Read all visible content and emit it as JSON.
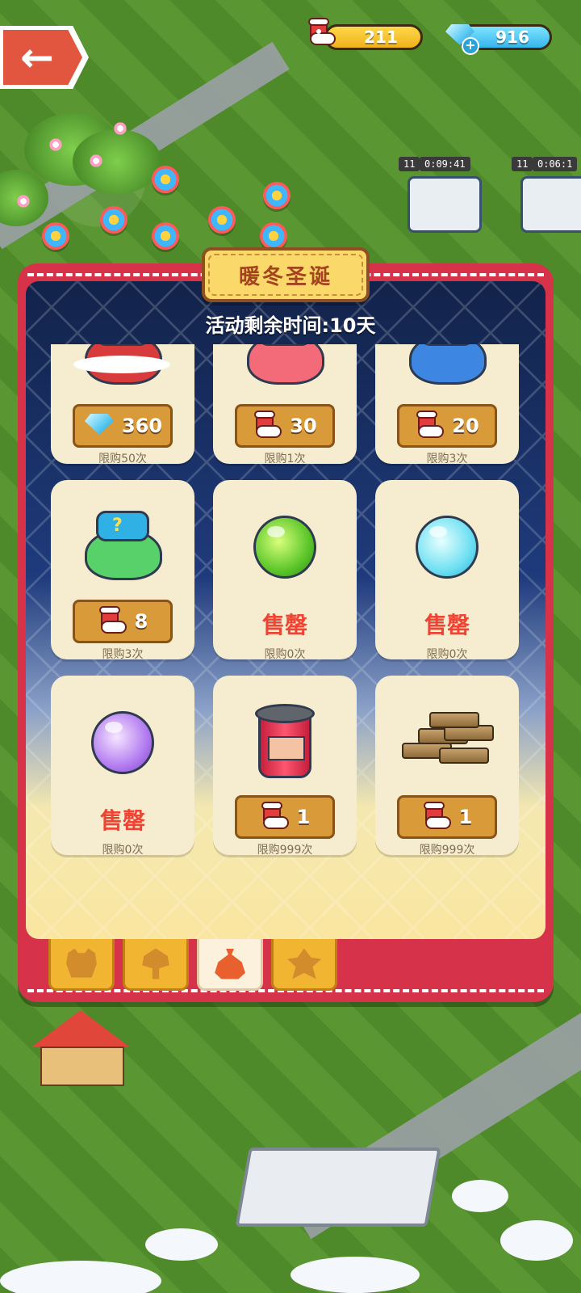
{
  "hud": {
    "sock_count": "211",
    "gem_count": "916",
    "back_icon": "back-arrow-icon",
    "sock_icon": "christmas-sock-icon",
    "gem_icon": "diamond-plus-icon"
  },
  "world": {
    "timer_a": "0:09:41",
    "timer_b": "0:06:1",
    "level_a": "11",
    "level_b": "11"
  },
  "dialog": {
    "title": "暖冬圣诞",
    "remaining": "活动剩余时间:10天"
  },
  "items": [
    {
      "art": "christmas-gift-sack",
      "currency": "gem",
      "price": "360",
      "limit": "限购50次"
    },
    {
      "art": "pink-robot-bed",
      "currency": "sock",
      "price": "30",
      "limit": "限购1次"
    },
    {
      "art": "blue-robot-bed",
      "currency": "sock",
      "price": "20",
      "limit": "限购3次"
    },
    {
      "art": "mystery-box-sack",
      "currency": "sock",
      "price": "8",
      "limit": "限购3次"
    },
    {
      "art": "green-orb",
      "sold_out": "售罄",
      "limit": "限购0次"
    },
    {
      "art": "ice-orb",
      "sold_out": "售罄",
      "limit": "限购0次"
    },
    {
      "art": "purple-orb",
      "sold_out": "售罄",
      "limit": "限购0次"
    },
    {
      "art": "red-can",
      "currency": "sock",
      "price": "1",
      "limit": "限购999次"
    },
    {
      "art": "wood-logs",
      "currency": "sock",
      "price": "1",
      "limit": "限购999次"
    }
  ],
  "tabs": [
    {
      "icon": "bear-icon",
      "active": false
    },
    {
      "icon": "tree-icon",
      "active": false
    },
    {
      "icon": "bag-icon",
      "active": true
    },
    {
      "icon": "leaf-icon",
      "active": false
    }
  ],
  "colors": {
    "panel_red": "#d6334b",
    "price_gold": "#d99a3a",
    "sold_out_red": "#ef4433",
    "title_plate": "#fbd86a"
  }
}
